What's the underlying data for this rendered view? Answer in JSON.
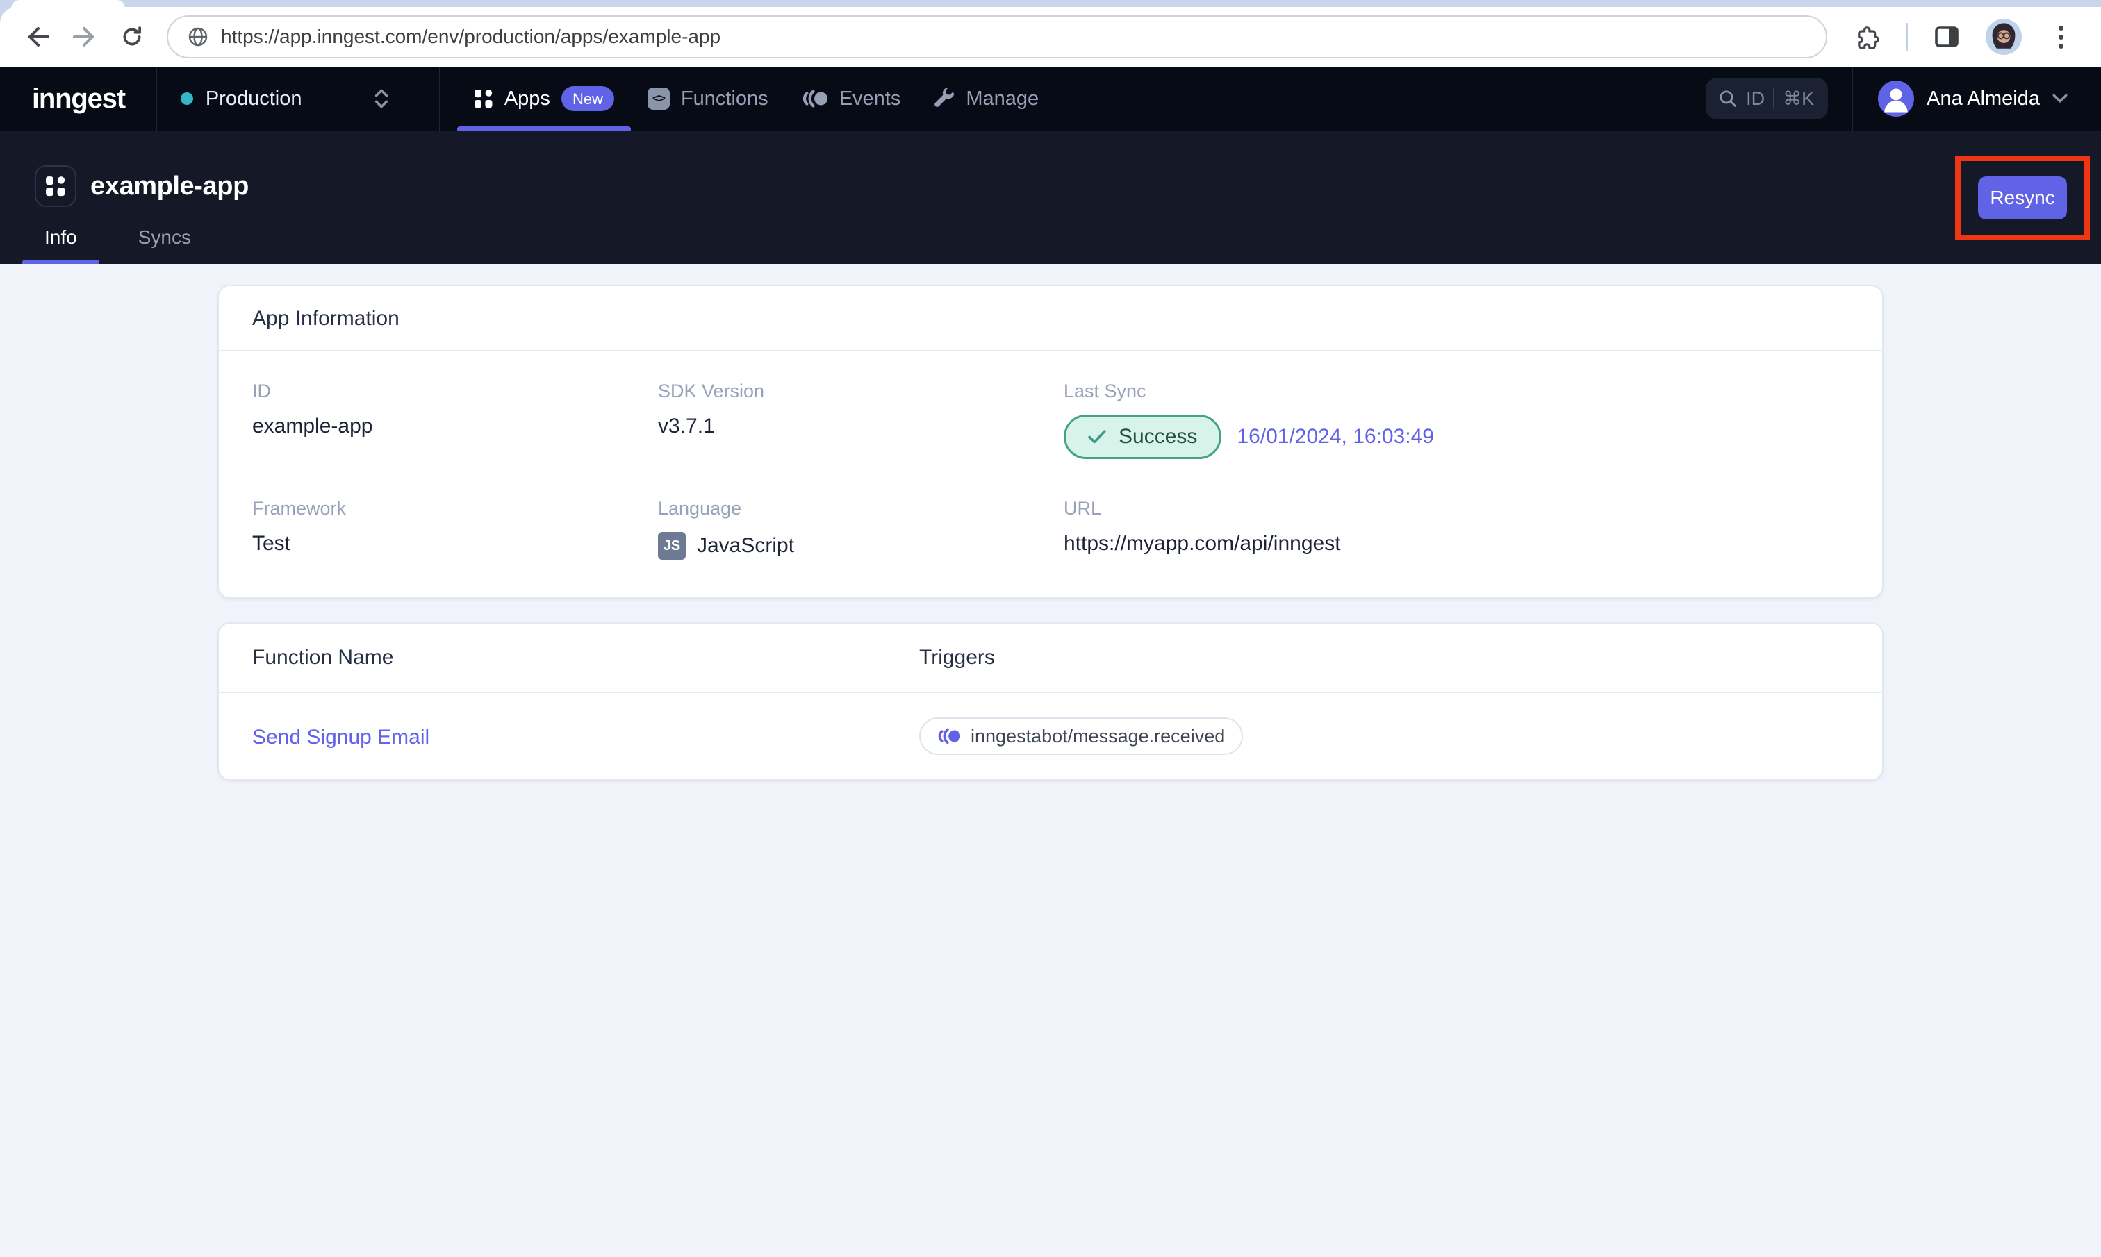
{
  "browser": {
    "url": "https://app.inngest.com/env/production/apps/example-app"
  },
  "navbar": {
    "logo": "inngest",
    "environment": "Production",
    "items": [
      {
        "label": "Apps",
        "badge": "New"
      },
      {
        "label": "Functions"
      },
      {
        "label": "Events"
      },
      {
        "label": "Manage"
      }
    ],
    "search": {
      "label": "ID",
      "shortcut": "⌘K"
    },
    "user": {
      "name": "Ana Almeida"
    }
  },
  "page_header": {
    "title": "example-app",
    "tabs": [
      {
        "label": "Info",
        "active": true
      },
      {
        "label": "Syncs",
        "active": false
      }
    ],
    "resync_label": "Resync"
  },
  "app_info": {
    "title": "App Information",
    "fields": [
      {
        "label": "ID",
        "value": "example-app"
      },
      {
        "label": "SDK Version",
        "value": "v3.7.1"
      },
      {
        "label": "Last Sync",
        "status": "Success",
        "timestamp": "16/01/2024, 16:03:49"
      },
      {
        "label": "Framework",
        "value": "Test"
      },
      {
        "label": "Language",
        "badge": "JS",
        "value": "JavaScript"
      },
      {
        "label": "URL",
        "value": "https://myapp.com/api/inngest"
      }
    ]
  },
  "functions_table": {
    "columns": [
      "Function Name",
      "Triggers"
    ],
    "rows": [
      {
        "name": "Send Signup Email",
        "trigger": "inngestabot/message.received"
      }
    ]
  },
  "colors": {
    "accent": "#6163e6",
    "annotation": "#ee3615",
    "env_dot": "#35b5c6",
    "success_bg": "#d8f4ea",
    "success_border": "#44a28c",
    "success_text": "#254d43"
  }
}
